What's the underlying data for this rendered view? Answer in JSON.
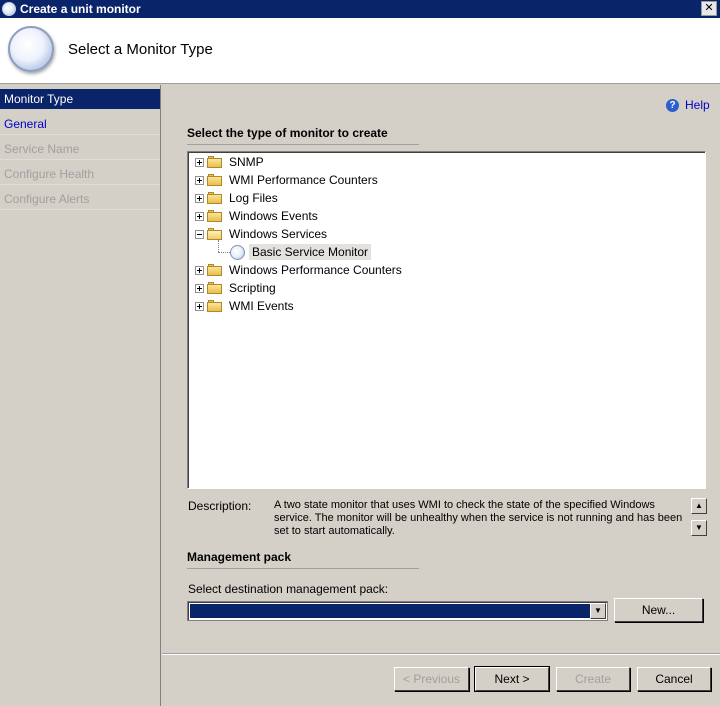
{
  "window": {
    "title": "Create a unit monitor",
    "close_glyph": "✕"
  },
  "header": {
    "title": "Select a Monitor Type",
    "icon": "globe-icon"
  },
  "nav": {
    "items": [
      {
        "label": "Monitor Type",
        "state": "active"
      },
      {
        "label": "General",
        "state": "link"
      },
      {
        "label": "Service Name",
        "state": "disabled"
      },
      {
        "label": "Configure Health",
        "state": "disabled"
      },
      {
        "label": "Configure Alerts",
        "state": "disabled"
      }
    ]
  },
  "help": {
    "label": "Help",
    "icon": "help-icon"
  },
  "monitor_type": {
    "section_title": "Select the type of monitor to create",
    "tree": [
      {
        "label": "SNMP",
        "expanded": false
      },
      {
        "label": "WMI Performance Counters",
        "expanded": false
      },
      {
        "label": "Log Files",
        "expanded": false
      },
      {
        "label": "Windows Events",
        "expanded": false
      },
      {
        "label": "Windows Services",
        "expanded": true
      },
      {
        "label": "Windows Performance Counters",
        "expanded": false
      },
      {
        "label": "Scripting",
        "expanded": false
      },
      {
        "label": "WMI Events",
        "expanded": false
      }
    ],
    "selected_leaf": "Basic Service Monitor"
  },
  "description": {
    "label": "Description:",
    "text": "A two state monitor that uses WMI to check the state of the specified Windows service.  The monitor will be unhealthy when the service is not running and has been set to start automatically."
  },
  "management_pack": {
    "section_title": "Management pack",
    "dest_label": "Select destination management pack:",
    "selected_value": "",
    "new_button": "New..."
  },
  "footer": {
    "previous": "< Previous",
    "next": "Next >",
    "create": "Create",
    "cancel": "Cancel"
  }
}
